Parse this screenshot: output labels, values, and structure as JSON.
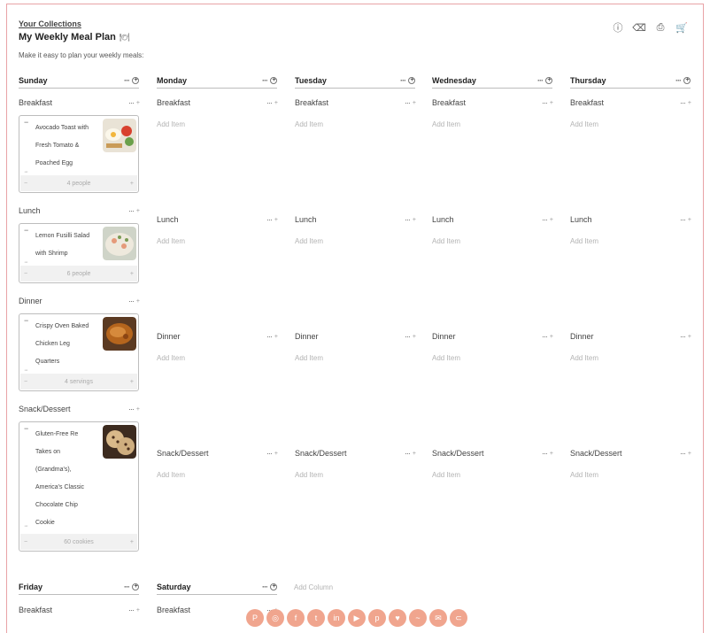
{
  "header": {
    "collections_link": "Your Collections",
    "plan_title": "My Weekly Meal Plan",
    "plan_emoji": "🍽",
    "subtitle": "Make it easy to plan your weekly meals:"
  },
  "toolbar_icons": [
    "info-icon",
    "clear-icon",
    "print-icon",
    "cart-icon"
  ],
  "days": {
    "sunday": "Sunday",
    "monday": "Monday",
    "tuesday": "Tuesday",
    "wednesday": "Wednesday",
    "thursday": "Thursday",
    "friday": "Friday",
    "saturday": "Saturday"
  },
  "sections": {
    "breakfast": "Breakfast",
    "lunch": "Lunch",
    "dinner": "Dinner",
    "snack": "Snack/Dessert"
  },
  "add_item": "Add Item",
  "add_column": "Add Column",
  "dots": "···",
  "recipes": {
    "breakfast": {
      "lines": [
        "Avocado Toast with",
        "Fresh Tomato &",
        "Poached Egg"
      ],
      "servings": "4 people"
    },
    "lunch": {
      "lines": [
        "Lemon Fusilli Salad",
        "with Shrimp"
      ],
      "servings": "6 people"
    },
    "dinner": {
      "lines": [
        "Crispy Oven Baked",
        "Chicken Leg",
        "Quarters"
      ],
      "servings": "4 servings"
    },
    "snack": {
      "lines": [
        "Gluten-Free Re",
        "Takes on",
        "(Grandma's),",
        "America's Classic",
        "Chocolate Chip",
        "Cookie"
      ],
      "servings": "60 cookies"
    }
  },
  "social_icons": [
    "pinterest-icon",
    "instagram-icon",
    "facebook-icon",
    "twitter-icon",
    "linkedin-icon",
    "youtube-icon",
    "pinterest-alt-icon",
    "pocket-icon",
    "messenger-icon",
    "email-icon",
    "rss-icon"
  ],
  "colors": {
    "accent": "#f0a58e",
    "frame": "#e8a3a6"
  }
}
